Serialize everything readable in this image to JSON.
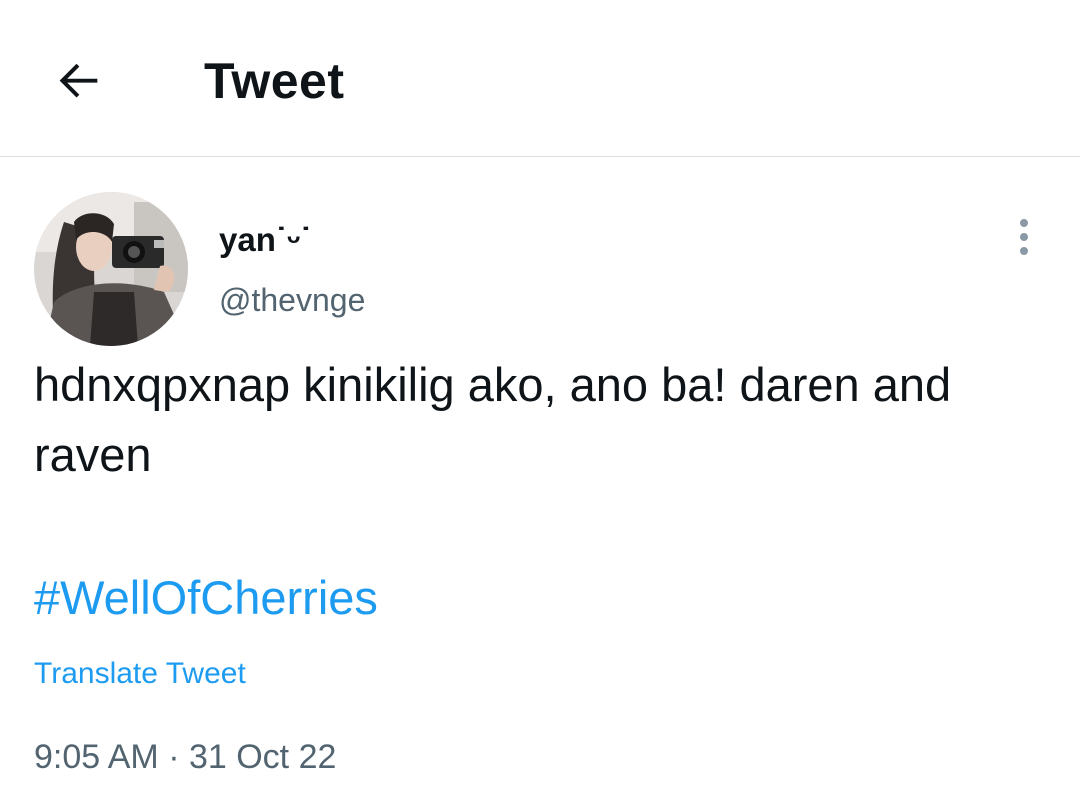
{
  "header": {
    "back_icon": "arrow-left-icon",
    "title": "Tweet"
  },
  "tweet": {
    "author": {
      "display_name": "yan˙ᵕ˙",
      "handle": "@thevnge",
      "avatar": "profile-photo"
    },
    "more_icon": "more-vertical-icon",
    "text": "hdnxqpxnap kinikilig ako, ano ba! daren and raven",
    "hashtag": "#WellOfCherries",
    "translate_label": "Translate Tweet",
    "time": "9:05 AM",
    "separator": " · ",
    "date": "31 Oct 22"
  },
  "colors": {
    "link": "#1d9bf0",
    "secondary_text": "#536471",
    "primary_text": "#0f1419",
    "divider": "#dcdfe2"
  }
}
